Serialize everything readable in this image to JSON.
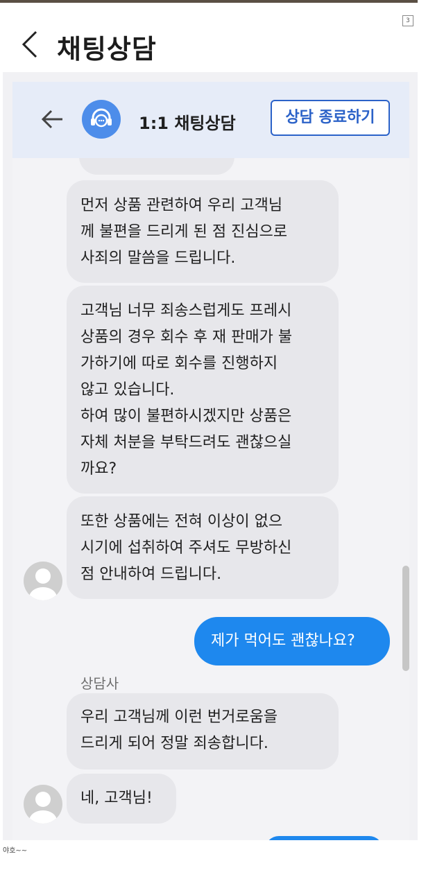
{
  "page": {
    "indicator": "3",
    "caption": "야호~~"
  },
  "outer_header": {
    "back_icon": "chevron-left-icon",
    "title": "채팅상담"
  },
  "chat_header": {
    "back_icon": "arrow-left-icon",
    "avatar_icon": "headset-icon",
    "title": "1:1 채팅상담",
    "end_button_label": "상담 종료하기",
    "accent_color": "#2b62c8"
  },
  "messages": [
    {
      "role": "agent",
      "text": "먼저 상품 관련하여 우리 고객님\n께 불편을 드리게 된 점 진심으로\n사죄의 말씀을 드립니다."
    },
    {
      "role": "agent",
      "text": "고객님 너무 죄송스럽게도 프레시\n상품의 경우 회수 후 재 판매가 불\n가하기에 따로 회수를 진행하지\n않고 있습니다.\n하여 많이 불편하시겠지만 상품은\n자체 처분을 부탁드려도 괜찮으실\n까요?"
    },
    {
      "role": "agent",
      "text": "또한 상품에는 전혀 이상이 없으\n시기에 섭취하여 주셔도 무방하신\n점 안내하여 드립니다."
    },
    {
      "role": "user",
      "text": "제가 먹어도 괜찮나요?"
    },
    {
      "role": "agent",
      "text": "우리 고객님께 이런 번거로움을\n드리게 되어 정말 죄송합니다."
    },
    {
      "role": "agent",
      "text": "네, 고객님!"
    }
  ],
  "sender_label": "상담사",
  "colors": {
    "user_bubble": "#1e88ee",
    "agent_bubble": "#e7e7eb",
    "header_bg": "#e6ecf8"
  }
}
